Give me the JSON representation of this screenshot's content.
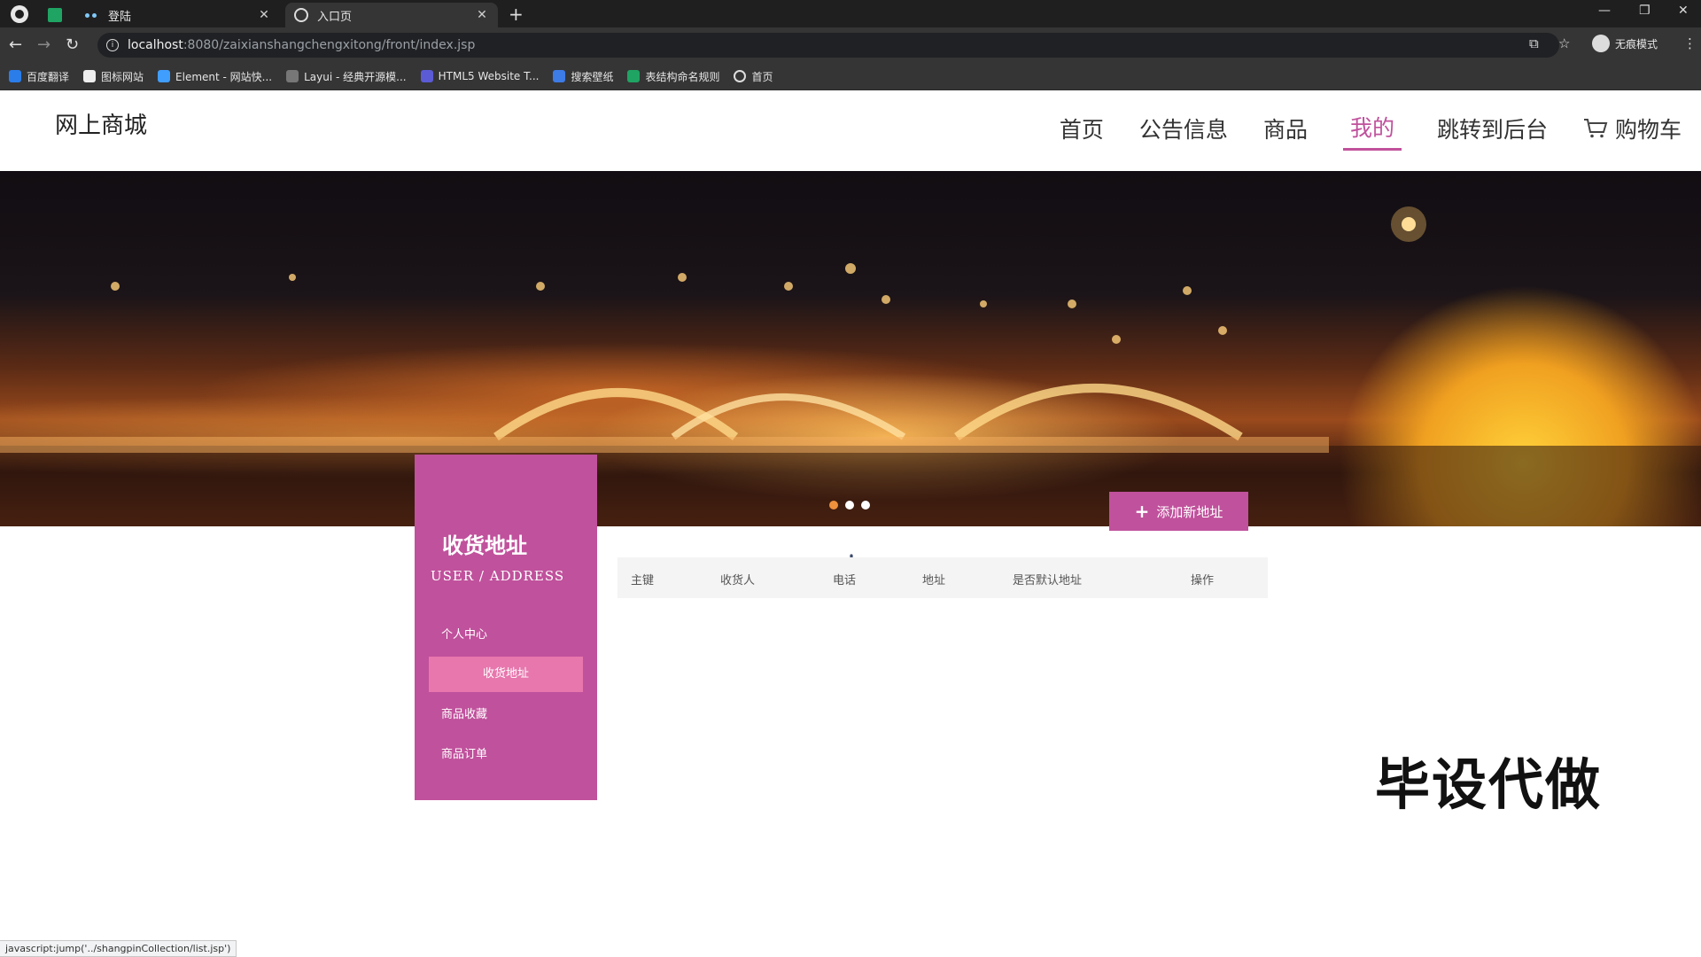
{
  "browser": {
    "tabs": [
      {
        "label": "",
        "icon": "sheet-icon"
      },
      {
        "label": "登陆",
        "icon": "dots-icon"
      },
      {
        "label": "入口页",
        "icon": "globe-icon"
      }
    ],
    "url_host": "localhost",
    "url_path": ":8080/zaixianshangchengxitong/front/index.jsp",
    "incognito_label": "无痕模式",
    "bookmarks": [
      "百度翻译",
      "图标网站",
      "Element - 网站快...",
      "Layui - 经典开源模...",
      "HTML5 Website T...",
      "搜索壁纸",
      "表结构命名规则",
      "首页"
    ]
  },
  "site": {
    "logo": "网上商城",
    "nav": [
      "首页",
      "公告信息",
      "商品",
      "我的",
      "跳转到后台",
      "购物车"
    ],
    "active_nav": "我的"
  },
  "banner": {
    "carousel_dots": 3,
    "active_dot": 1
  },
  "sidebar": {
    "title": "收货地址",
    "subtitle": "USER / ADDRESS",
    "items": [
      "个人中心",
      "收货地址",
      "商品收藏",
      "商品订单"
    ],
    "active_item": "收货地址"
  },
  "main": {
    "add_button": "添加新地址",
    "table_headers": [
      "主键",
      "收货人",
      "电话",
      "地址",
      "是否默认地址",
      "操作"
    ]
  },
  "watermark": "毕设代做",
  "status_bar": "javascript:jump('../shangpinCollection/list.jsp')",
  "colors": {
    "accent": "#c0519c",
    "accent_light": "#e777ad",
    "chrome_dark": "#1f1f1f",
    "chrome_toolbar": "#353535"
  }
}
